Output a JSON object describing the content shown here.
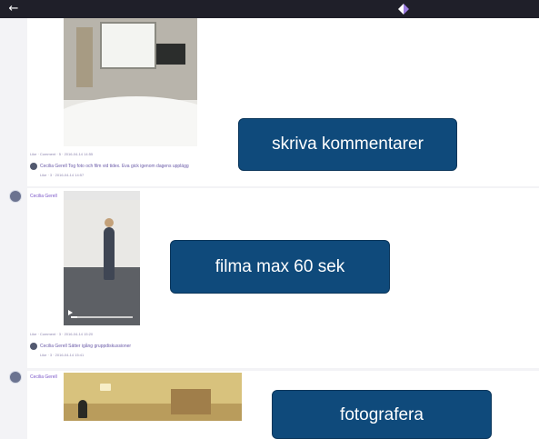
{
  "topbar": {
    "back_icon": "arrow-left-icon",
    "logo_icon": "app-logo-icon",
    "colors": {
      "bar": "#1f1f29",
      "logo_left": "#ffffff",
      "logo_right": "#9b7be0"
    }
  },
  "posts": [
    {
      "author": "",
      "meta": "Like · Comment · 5 · 2016-04-14 14:55",
      "comment_author": "Cecilia Gerell",
      "comment_text": "Tog foto och film vid tidex. Eva gick igenom dagens upplägg",
      "comment_meta": "Like · 3 · 2016-04-14 14:57"
    },
    {
      "author": "Cecilia Gerell",
      "video_progress": 0.1,
      "meta": "Like · Comment · 3 · 2016-04-14 15:20",
      "comment_author": "Cecilia Gerell",
      "comment_text": "Sätter igång gruppdiskussioner",
      "comment_meta": "Like · 3 · 2016-04-14 15:41"
    },
    {
      "author": "Cecilia Gerell"
    }
  ],
  "callouts": {
    "one": "skriva kommentarer",
    "two": "filma max 60 sek",
    "three": "fotografera"
  },
  "colors": {
    "callout_bg": "#0f4a7b",
    "author": "#7a55c8",
    "feed_bg": "#f3f3f6"
  }
}
